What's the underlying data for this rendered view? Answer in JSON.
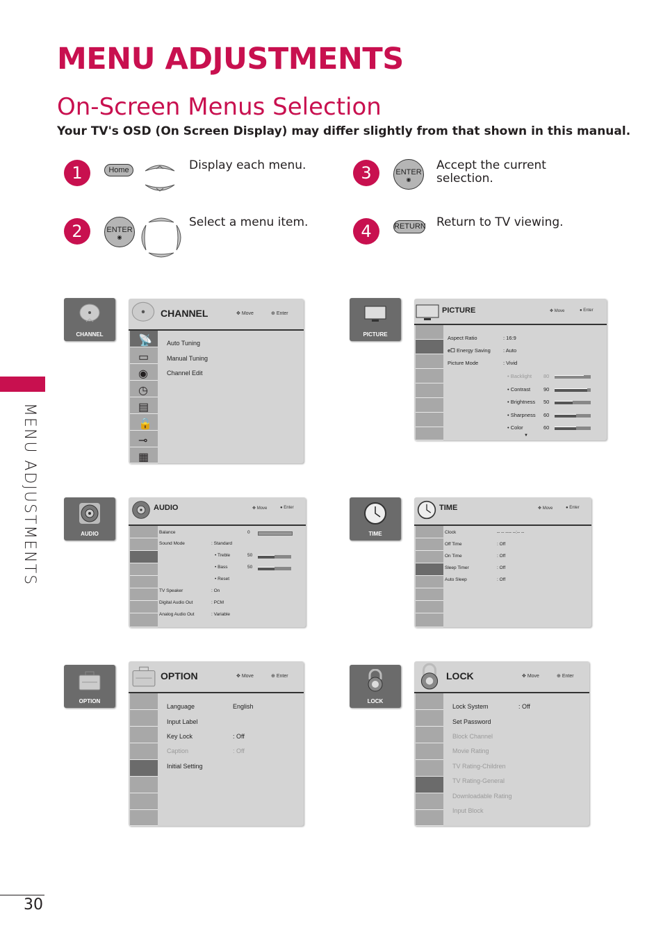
{
  "page": {
    "title": "MENU ADJUSTMENTS",
    "section_title": "On-Screen Menus Selection",
    "subtitle": "Your TV's OSD (On Screen Display) may differ slightly from that shown in this manual.",
    "side_tab": "MENU ADJUSTMENTS",
    "page_number": "30",
    "accent_color": "#c8104f"
  },
  "steps": [
    {
      "number": "1",
      "button": "Home",
      "text": "Display each menu."
    },
    {
      "number": "2",
      "button": "ENTER",
      "text": "Select a menu item."
    },
    {
      "number": "3",
      "button": "ENTER",
      "text": "Accept the current selection."
    },
    {
      "number": "4",
      "button": "RETURN",
      "text": "Return to TV viewing."
    }
  ],
  "hints": {
    "move": "Move",
    "enter": "Enter"
  },
  "menus": {
    "channel": {
      "tile_label": "CHANNEL",
      "title": "CHANNEL",
      "items": [
        {
          "label": "Auto Tuning",
          "value": ""
        },
        {
          "label": "Manual Tuning",
          "value": ""
        },
        {
          "label": "Channel Edit",
          "value": ""
        }
      ]
    },
    "picture": {
      "tile_label": "PICTURE",
      "title": "PICTURE",
      "items": [
        {
          "label": "Aspect Ratio",
          "value": ": 16:9"
        },
        {
          "label": "Energy Saving",
          "value": ": Auto"
        },
        {
          "label": "Picture Mode",
          "value": ": Vivid"
        }
      ],
      "sliders": [
        {
          "label": "• Backlight",
          "value": "80",
          "level": 0.8,
          "dim": true
        },
        {
          "label": "• Contrast",
          "value": "90",
          "level": 0.9,
          "dim": false
        },
        {
          "label": "• Brightness",
          "value": "50",
          "level": 0.5,
          "dim": false
        },
        {
          "label": "• Sharpness",
          "value": "60",
          "level": 0.6,
          "dim": false
        },
        {
          "label": "• Color",
          "value": "60",
          "level": 0.6,
          "dim": false
        }
      ],
      "more_indicator": "▼"
    },
    "audio": {
      "tile_label": "AUDIO",
      "title": "AUDIO",
      "balance": {
        "label": "Balance",
        "value": "0"
      },
      "sound_mode": {
        "label": "Sound Mode",
        "value": ": Standard"
      },
      "sliders": [
        {
          "label": "• Treble",
          "value": "50",
          "level": 0.5
        },
        {
          "label": "• Bass",
          "value": "50",
          "level": 0.5
        }
      ],
      "reset": "• Reset",
      "items": [
        {
          "label": "TV Speaker",
          "value": ": On"
        },
        {
          "label": "Digital Audio Out",
          "value": ": PCM"
        },
        {
          "label": "Analog Audio Out",
          "value": ": Variable"
        }
      ]
    },
    "time": {
      "tile_label": "TIME",
      "title": "TIME",
      "items": [
        {
          "label": "Clock",
          "value": "-- -- ---- --:-- --"
        },
        {
          "label": "Off Time",
          "value": ": Off"
        },
        {
          "label": "On Time",
          "value": ": Off"
        },
        {
          "label": "Sleep Timer",
          "value": ": Off"
        },
        {
          "label": "Auto Sleep",
          "value": ": Off"
        }
      ]
    },
    "option": {
      "tile_label": "OPTION",
      "title": "OPTION",
      "items": [
        {
          "label": "Language",
          "value": "English"
        },
        {
          "label": "Input Label",
          "value": ""
        },
        {
          "label": "Key Lock",
          "value": ": Off"
        },
        {
          "label": "Caption",
          "value": ": Off",
          "dim": true
        },
        {
          "label": "Initial Setting",
          "value": ""
        }
      ]
    },
    "lock": {
      "tile_label": "LOCK",
      "title": "LOCK",
      "items": [
        {
          "label": "Lock System",
          "value": ": Off"
        },
        {
          "label": "Set Password",
          "value": ""
        },
        {
          "label": "Block Channel",
          "value": "",
          "dim": true
        },
        {
          "label": "Movie Rating",
          "value": "",
          "dim": true
        },
        {
          "label": "TV Rating-Children",
          "value": "",
          "dim": true
        },
        {
          "label": "TV Rating-General",
          "value": "",
          "dim": true
        },
        {
          "label": "Downloadable Rating",
          "value": "",
          "dim": true
        },
        {
          "label": "Input Block",
          "value": "",
          "dim": true
        }
      ]
    }
  }
}
